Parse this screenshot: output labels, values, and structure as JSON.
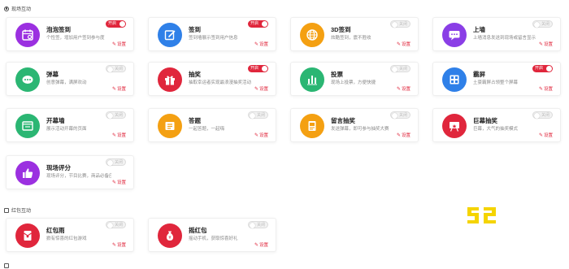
{
  "sections": [
    {
      "title": "现场互动"
    },
    {
      "title": "红包互动"
    }
  ],
  "cards": [
    {
      "id": "bubble-checkin",
      "title": "泡泡签到",
      "desc": "个性签，增加用户签到参与度",
      "on": true,
      "color": "#9b30e0",
      "icon": "calendar-icon"
    },
    {
      "id": "checkin",
      "title": "签到",
      "desc": "签到墙展示签到用户信息",
      "on": true,
      "color": "#2f80e8",
      "icon": "edit-icon"
    },
    {
      "id": "3d-checkin",
      "title": "3D签到",
      "desc": "炫酷签到，震不胜收",
      "on": false,
      "color": "#f4a012",
      "icon": "globe-icon"
    },
    {
      "id": "wall",
      "title": "上墙",
      "desc": "上墙消息发送到现场或留言显示",
      "on": false,
      "color": "#8a3ee6",
      "icon": "chat-icon"
    },
    {
      "id": "danmaku",
      "title": "弹幕",
      "desc": "创意弹幕，满屏欢动",
      "on": false,
      "color": "#2bb673",
      "icon": "dots-icon"
    },
    {
      "id": "lottery",
      "title": "抽奖",
      "desc": "抽取幸运者实现最浪漫抽奖活动",
      "on": true,
      "color": "#e0263c",
      "icon": "gift-icon"
    },
    {
      "id": "vote",
      "title": "投票",
      "desc": "现场上投票，方便快捷",
      "on": false,
      "color": "#2bb673",
      "icon": "bar-chart-icon"
    },
    {
      "id": "screen",
      "title": "霸屏",
      "desc": "土豪霸屏占领整个屏幕",
      "on": true,
      "color": "#2f80e8",
      "icon": "screen-icon"
    },
    {
      "id": "opening-wall",
      "title": "开幕墙",
      "desc": "展示活动开幕的页面",
      "on": false,
      "color": "#2bb673",
      "icon": "window-icon"
    },
    {
      "id": "quiz",
      "title": "答题",
      "desc": "一起答题，一起嗨",
      "on": false,
      "color": "#f4a012",
      "icon": "quiz-icon"
    },
    {
      "id": "message-lottery",
      "title": "留言抽奖",
      "desc": "发送弹幕，即可参与抽奖大赛",
      "on": false,
      "color": "#f4a012",
      "icon": "message-icon"
    },
    {
      "id": "giant-lottery",
      "title": "巨幕抽奖",
      "desc": "巨幕，大气的抽奖模式",
      "on": false,
      "color": "#e0263c",
      "icon": "projector-icon"
    },
    {
      "id": "live-rating",
      "title": "现场评分",
      "desc": "现场评分，节目比赛，商品必备应用",
      "on": false,
      "color": "#9b30e0",
      "icon": "thumb-up-icon"
    },
    {
      "id": "red-packet-rain",
      "title": "红包雨",
      "desc": "掀有惊喜的红包游戏",
      "on": false,
      "color": "#e0263c",
      "icon": "envelope-icon"
    },
    {
      "id": "shake-red-packet",
      "title": "摇红包",
      "desc": "摇动手机，获取惊喜好礼",
      "on": false,
      "color": "#e0263c",
      "icon": "money-bag-icon"
    }
  ],
  "labels": {
    "toggle_on": "开启",
    "toggle_off": "关闭",
    "settings": "设置"
  },
  "watermark": "52"
}
